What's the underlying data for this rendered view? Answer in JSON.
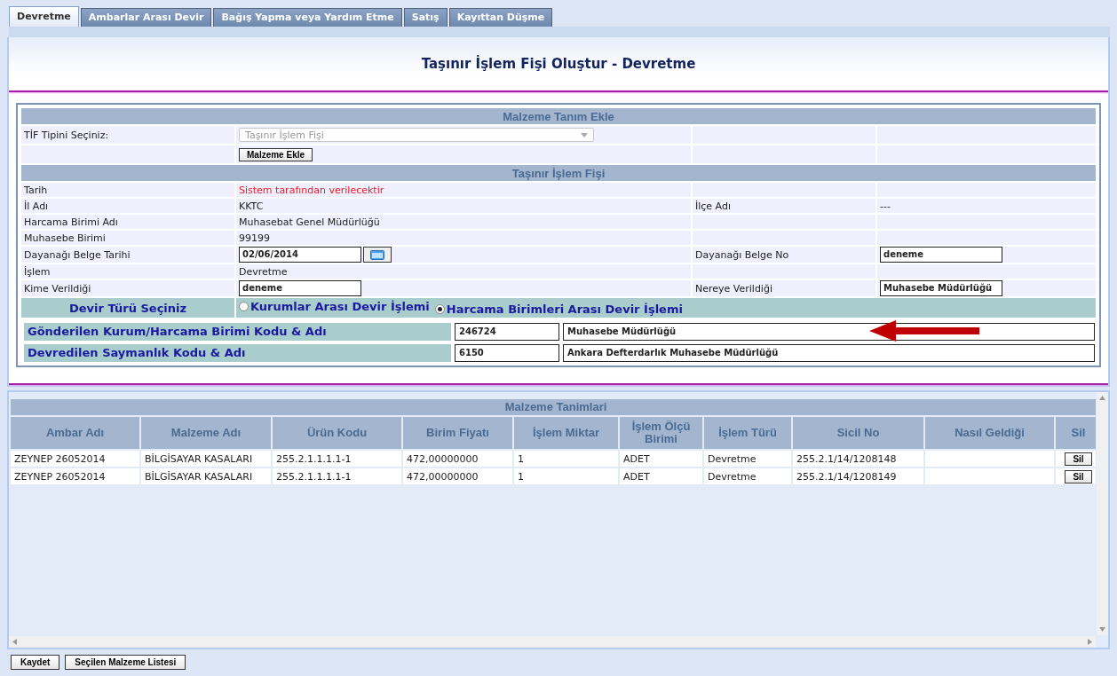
{
  "tabs": [
    {
      "label": "Devretme",
      "selected": true
    },
    {
      "label": "Ambarlar Arası Devir",
      "selected": false
    },
    {
      "label": "Bağış Yapma veya Yardım Etme",
      "selected": false
    },
    {
      "label": "Satış",
      "selected": false
    },
    {
      "label": "Kayıttan Düşme",
      "selected": false
    }
  ],
  "title": "Taşınır İşlem Fişi Oluştur - Devretme",
  "add_section": {
    "title": "Malzeme Tanım Ekle",
    "tif_label": "TİF Tipini Seçiniz:",
    "tif_select": {
      "value": "Taşınır İşlem Fişi",
      "disabled": true
    },
    "add_button": "Malzeme Ekle"
  },
  "fis_section": {
    "title": "Taşınır İşlem Fişi",
    "rows": [
      {
        "label": "Tarih",
        "value": {
          "kind": "warning",
          "text": "Sistem tarafından verilecektir"
        }
      },
      {
        "label": "İl Adı",
        "value": {
          "kind": "text",
          "text": "KKTC"
        },
        "label_2": "İlçe Adı",
        "value_2": {
          "kind": "text",
          "text": "---"
        }
      },
      {
        "label": "Harcama Birimi Adı",
        "value": {
          "kind": "text",
          "text": "Muhasebat Genel Müdürlüğü"
        }
      },
      {
        "label": "Muhasebe Birimi",
        "value": {
          "kind": "text",
          "text": "99199"
        }
      },
      {
        "label": "Dayanağı Belge Tarihi",
        "value": {
          "kind": "date",
          "text": "02/06/2014"
        },
        "label_2": "Dayanağı Belge No",
        "value_2": {
          "kind": "field",
          "text": "deneme"
        }
      },
      {
        "label": "İşlem",
        "value": {
          "kind": "text",
          "text": "Devretme"
        }
      },
      {
        "label": "Kime Verildiği",
        "value": {
          "kind": "field",
          "text": "deneme"
        },
        "label_2": "Nereye Verildiği",
        "value_2": {
          "kind": "field",
          "text": "Muhasebe Müdürlüğü"
        }
      }
    ]
  },
  "devir": {
    "label": "Devir Türü Seçiniz",
    "options": [
      {
        "label": "Kurumlar Arası Devir İşlemi",
        "selected": false
      },
      {
        "label": "Harcama Birimleri Arası Devir İşlemi",
        "selected": true
      }
    ]
  },
  "transfer_rows": [
    {
      "label": "Gönderilen Kurum/Harcama Birimi Kodu & Adı",
      "code": "246724",
      "name": "Muhasebe Müdürlüğü",
      "arrow": true
    },
    {
      "label": "Devredilen Saymanlık Kodu & Adı",
      "code": "6150",
      "name": "Ankara Defterdarlık Muhasebe Müdürlüğü",
      "arrow": false
    }
  ],
  "table": {
    "title": "Malzeme Tanimlari",
    "columns": [
      "Ambar Adı",
      "Malzeme Adı",
      "Ürün Kodu",
      "Birim Fiyatı",
      "İşlem Miktar",
      "İşlem Ölçü Birimi",
      "İşlem Türü",
      "Sicil No",
      "Nasıl Geldiği",
      "Sil"
    ],
    "rows": [
      {
        "cells": [
          "ZEYNEP 26052014",
          "BİLGİSAYAR KASALARI",
          "255.2.1.1.1.1-1",
          "472,00000000",
          "1",
          "ADET",
          "Devretme",
          "255.2.1/14/1208148",
          ""
        ],
        "action": "Sil"
      },
      {
        "cells": [
          "ZEYNEP 26052014",
          "BİLGİSAYAR KASALARI",
          "255.2.1.1.1.1-1",
          "472,00000000",
          "1",
          "ADET",
          "Devretme",
          "255.2.1/14/1208149",
          ""
        ],
        "action": "Sil"
      }
    ]
  },
  "buttons": [
    "Kaydet",
    "Seçilen Malzeme Listesi"
  ]
}
